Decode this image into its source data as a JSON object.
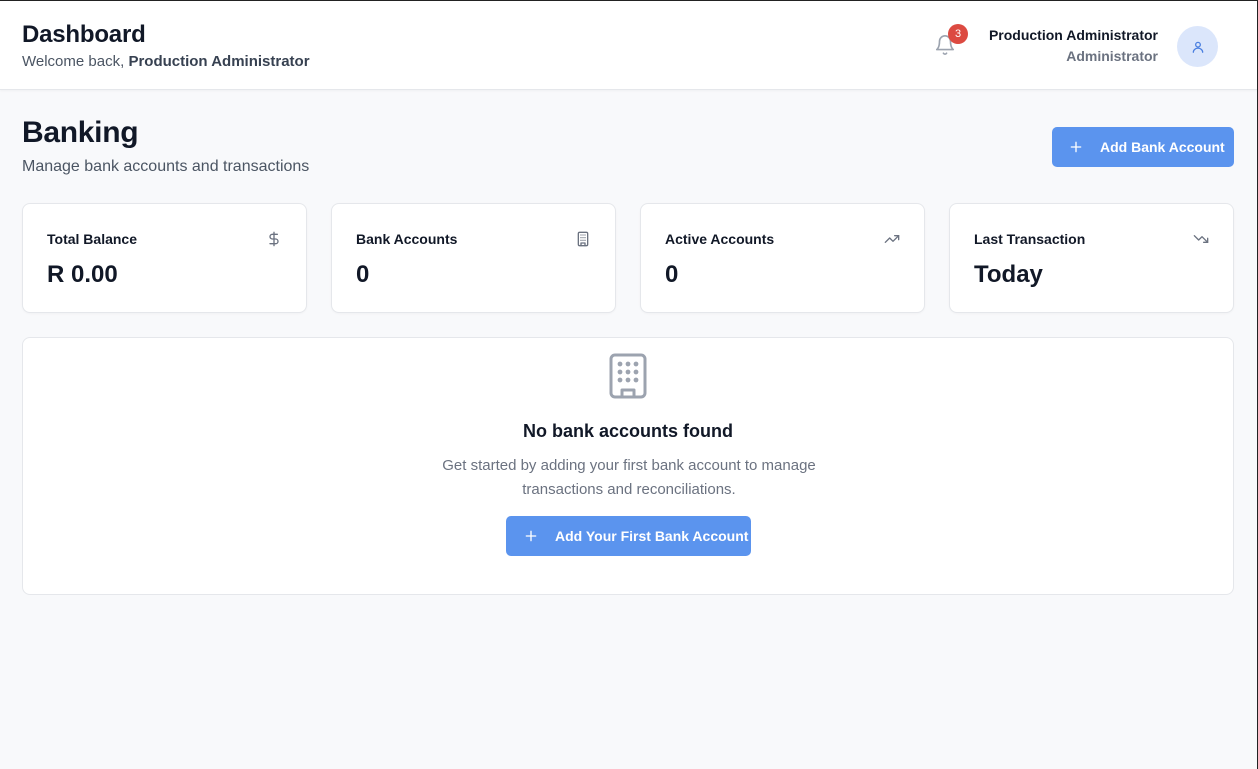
{
  "header": {
    "title": "Dashboard",
    "welcome_prefix": "Welcome back, ",
    "welcome_name": "Production Administrator",
    "notification_count": "3",
    "user_name": "Production Administrator",
    "user_role": "Administrator"
  },
  "page": {
    "title": "Banking",
    "subtitle": "Manage bank accounts and transactions",
    "add_button_label": "Add Bank Account"
  },
  "stats": [
    {
      "label": "Total Balance",
      "value": "R 0.00",
      "icon": "dollar-icon"
    },
    {
      "label": "Bank Accounts",
      "value": "0",
      "icon": "building-icon"
    },
    {
      "label": "Active Accounts",
      "value": "0",
      "icon": "trending-up-icon"
    },
    {
      "label": "Last Transaction",
      "value": "Today",
      "icon": "trending-down-icon"
    }
  ],
  "empty_state": {
    "icon": "building-icon",
    "title": "No bank accounts found",
    "description": "Get started by adding your first bank account to manage transactions and reconciliations.",
    "button_label": "Add Your First Bank Account"
  },
  "colors": {
    "primary": "#5b94ee",
    "badge": "#dc4a41",
    "avatar_bg": "#dbe6fb",
    "page_bg": "#f8f9fb"
  }
}
